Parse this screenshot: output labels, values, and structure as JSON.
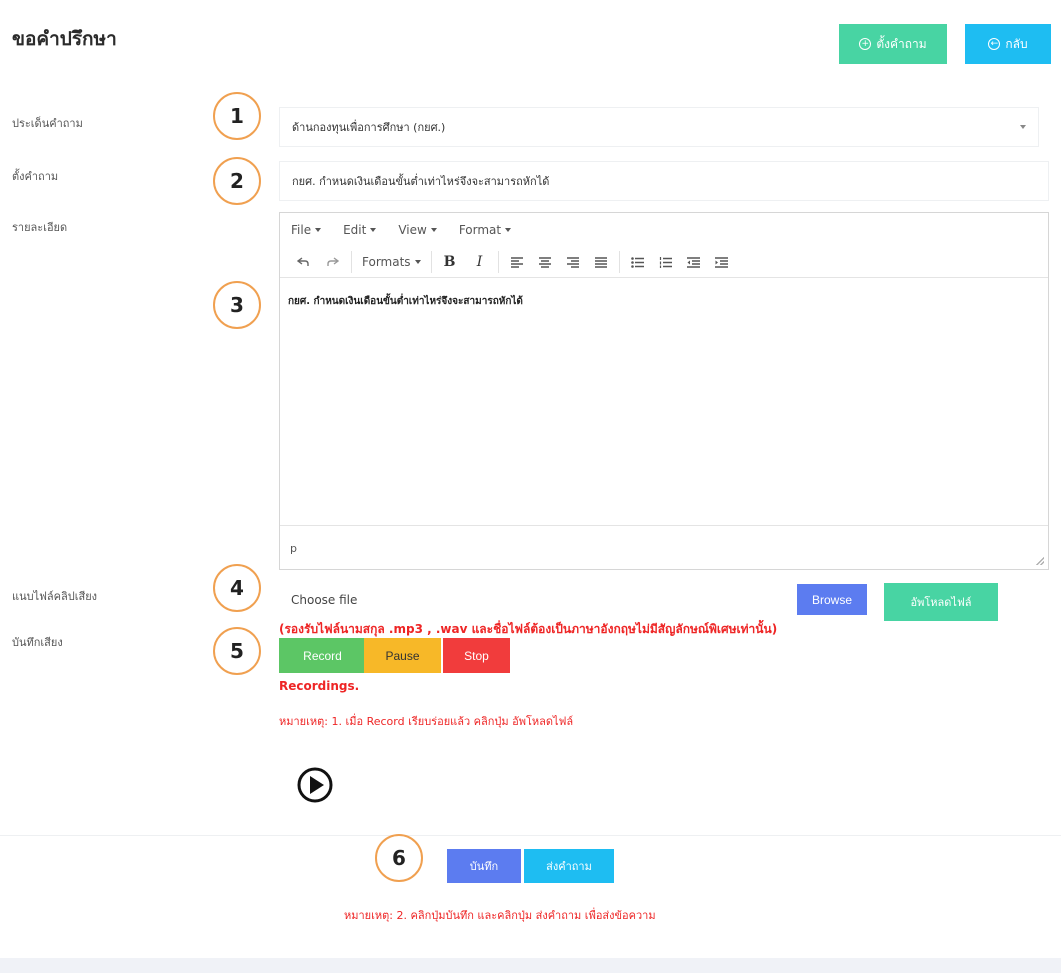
{
  "header": {
    "title": "ขอคำปรึกษา",
    "ask_button": "ตั้งคำถาม",
    "back_button": "กลับ"
  },
  "form": {
    "topic_label": "ประเด็นคำถาม",
    "topic_value": "ด้านกองทุนเพื่อการศึกษา (กยศ.)",
    "question_label": "ตั้งคำถาม",
    "question_value": "กยศ. กำหนดเงินเดือนขั้นต่ำเท่าไหร่จึงจะสามารถหักได้",
    "detail_label": "รายละเอียด",
    "attach_label": "แนบไฟล์คลิปเสียง",
    "record_label": "บันทึกเสียง"
  },
  "editor": {
    "menus": [
      "File",
      "Edit",
      "View",
      "Format"
    ],
    "formats_label": "Formats",
    "content": "กยศ. กำหนดเงินเดือนขั้นต่ำเท่าไหร่จึงจะสามารถหักได้",
    "status_path": "p"
  },
  "attach": {
    "choose_text": "Choose file",
    "browse_button": "Browse",
    "upload_button": "อัพโหลดไฟล์",
    "warning": "(รองรับไฟล์นามสกุล .mp3 , .wav และชื่อไฟล์ต้องเป็นภาษาอังกฤษไม่มีสัญลักษณ์พิเศษเท่านั้น)"
  },
  "recorder": {
    "record_button": "Record",
    "pause_button": "Pause",
    "stop_button": "Stop",
    "recordings_label": "Recordings.",
    "note": "หมายเหตุ: 1. เมื่อ Record เรียบร่อยแล้ว คลิกปุ่ม อัพโหลดไฟล์"
  },
  "footer": {
    "save_button": "บันทึก",
    "send_button": "ส่งคำถาม",
    "note": "หมายเหตุ: 2. คลิกปุ่มบันทึก และคลิกปุ่ม ส่งคำถาม เพื่อส่งข้อความ"
  },
  "badges": [
    "1",
    "2",
    "3",
    "4",
    "5",
    "6"
  ],
  "colors": {
    "green": "#48d4a3",
    "cyan": "#1ebdf2",
    "blue": "#5c7cf0",
    "red": "#ee2525",
    "badge_border": "#f0a050"
  },
  "icons": {
    "ask": "plus-circle-icon",
    "back": "arrow-left-circle-icon",
    "player": "play-circle-icon"
  }
}
